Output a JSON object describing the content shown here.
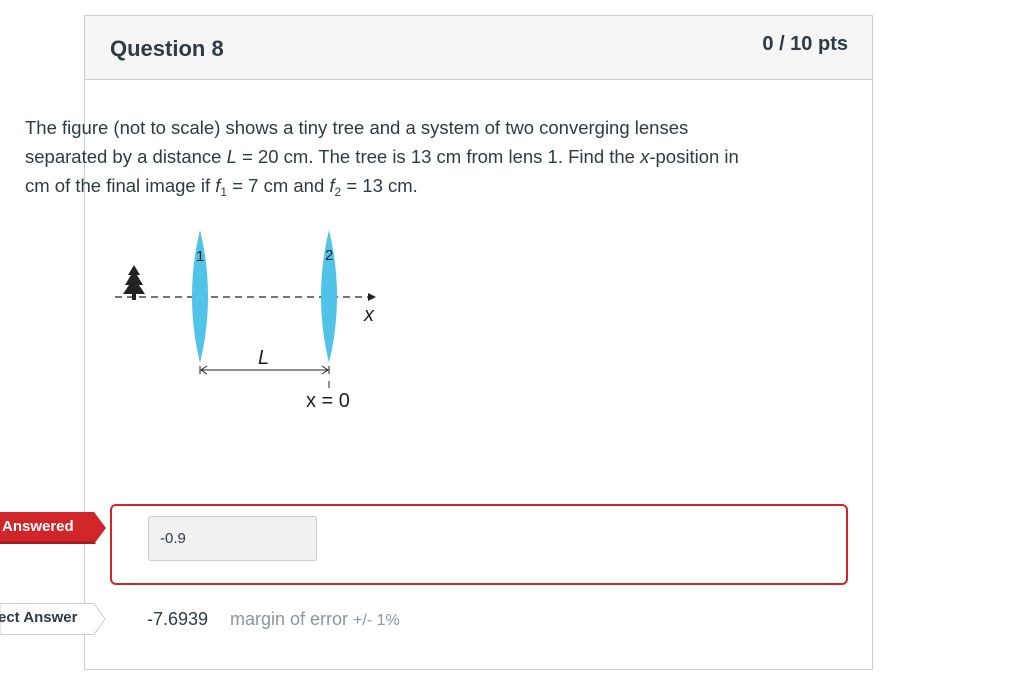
{
  "question": {
    "title": "Question 8",
    "points": "0 / 10 pts",
    "text_part1": "The figure (not to scale) shows a tiny tree and a system of two converging lenses separated by a distance ",
    "L_symbol": "L",
    "text_part2": " = 20 cm. The tree is 13 cm from lens 1. Find the ",
    "x_symbol": "x",
    "text_part3": "-position in cm of the final image if ",
    "f_symbol": "f",
    "f1_sub": "1",
    "text_part4": " = 7 cm and ",
    "f2_sub": "2",
    "text_part5": " = 13 cm."
  },
  "figure": {
    "lens1_label": "1",
    "lens2_label": "2",
    "distance_label": "L",
    "axis_label": "x",
    "origin_label": "x = 0",
    "lens_color": "#4fc3e8"
  },
  "answer": {
    "flag_label": "Answered",
    "value": "-0.9",
    "border_color": "#d0262a",
    "flag_color": "#d0262a"
  },
  "correct": {
    "flag_label": "ect Answer",
    "value": "-7.6939",
    "margin_label": "margin of error ",
    "margin_value": "+/- 1%"
  }
}
